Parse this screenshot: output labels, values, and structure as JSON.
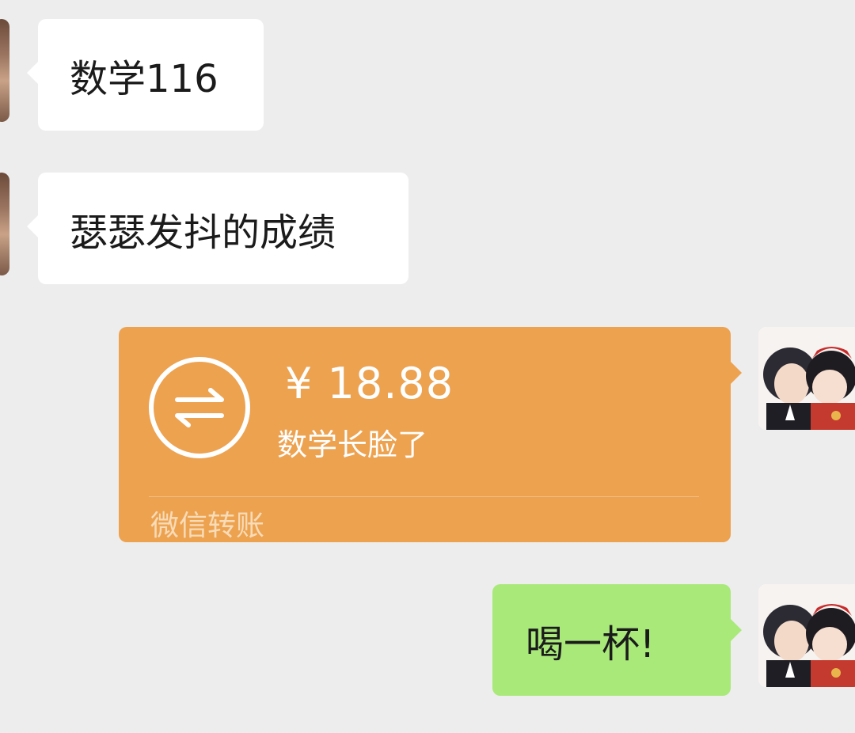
{
  "messages": {
    "m1": {
      "text": "数学116"
    },
    "m2": {
      "text": "瑟瑟发抖的成绩"
    },
    "transfer": {
      "amount": "¥ 18.88",
      "note": "数学长脸了",
      "footer": "微信转账",
      "icon": "transfer-arrows-icon"
    },
    "m3": {
      "text": "喝一杯!"
    }
  },
  "colors": {
    "background": "#ededed",
    "incoming_bubble": "#ffffff",
    "outgoing_bubble": "#a9e97a",
    "transfer_card": "#eda250"
  }
}
